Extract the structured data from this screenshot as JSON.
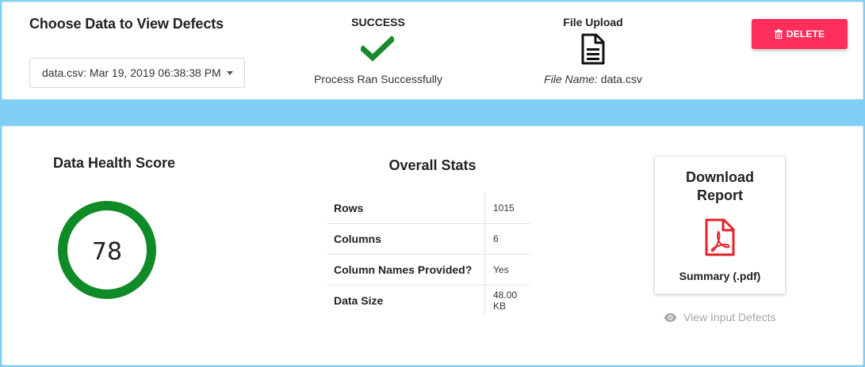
{
  "colors": {
    "page_background": "#7fd0f4",
    "success_green": "#178a2d",
    "gauge_green": "#0e8a26",
    "delete_red": "#ff2e5a",
    "pdf_red": "#e8202a",
    "muted_gray": "#a7a7a7"
  },
  "header": {
    "choose_title": "Choose Data to View Defects",
    "dataset_select": {
      "selected": "data.csv: Mar 19, 2019 06:38:38 PM",
      "icon": "caret-down-icon"
    },
    "status": {
      "title": "SUCCESS",
      "icon": "check-icon",
      "message": "Process Ran Successfully"
    },
    "upload": {
      "title": "File Upload",
      "icon": "file-text-icon",
      "file_name_label": "File Name:",
      "file_name": "data.csv"
    },
    "delete_button": {
      "label": "DELETE",
      "icon": "trash-icon"
    }
  },
  "health": {
    "title": "Data Health Score",
    "score": "78"
  },
  "stats": {
    "title": "Overall Stats",
    "rows": [
      {
        "label": "Rows",
        "value": "1015"
      },
      {
        "label": "Columns",
        "value": "6"
      },
      {
        "label": "Column Names Provided?",
        "value": "Yes"
      },
      {
        "label": "Data Size",
        "value": "48.00 KB"
      }
    ]
  },
  "download": {
    "title_line1": "Download",
    "title_line2": "Report",
    "icon": "pdf-file-icon",
    "label": "Summary (.pdf)"
  },
  "view_input_defects": {
    "label": "View Input Defects",
    "icon": "eye-icon"
  }
}
